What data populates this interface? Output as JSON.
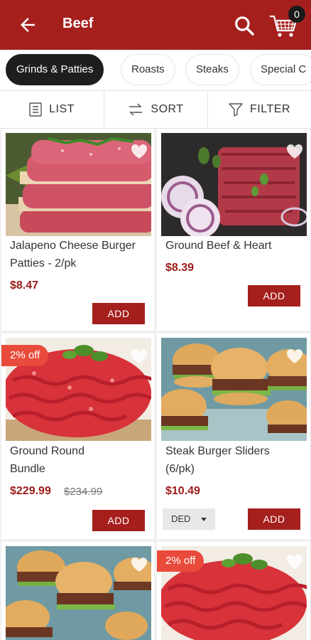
{
  "header": {
    "title": "Beef",
    "cart_count": "0"
  },
  "categories": [
    {
      "label": "Grinds & Patties",
      "active": true
    },
    {
      "label": "Roasts",
      "active": false
    },
    {
      "label": "Steaks",
      "active": false
    },
    {
      "label": "Special C",
      "active": false
    }
  ],
  "toolbar": {
    "list_label": "LIST",
    "sort_label": "SORT",
    "filter_label": "FILTER"
  },
  "products": [
    {
      "name": "Jalapeno Cheese Burger Patties - 2/pk",
      "price": "$8.47",
      "add_label": "ADD"
    },
    {
      "name": "Ground Beef & Heart",
      "price": "$8.39",
      "add_label": "ADD"
    },
    {
      "name": "Ground Round Bundle",
      "price": "$229.99",
      "old_price": "$234.99",
      "badge": "2% off",
      "add_label": "ADD"
    },
    {
      "name": "Steak Burger Sliders (6/pk)",
      "price": "$10.49",
      "unit": "DED",
      "add_label": "ADD"
    },
    {
      "name": "",
      "price": ""
    },
    {
      "name": "",
      "price": "",
      "badge": "2% off"
    }
  ],
  "colors": {
    "brand": "#a51f1c",
    "badge": "#e84b3c",
    "price": "#9c1a1a"
  }
}
